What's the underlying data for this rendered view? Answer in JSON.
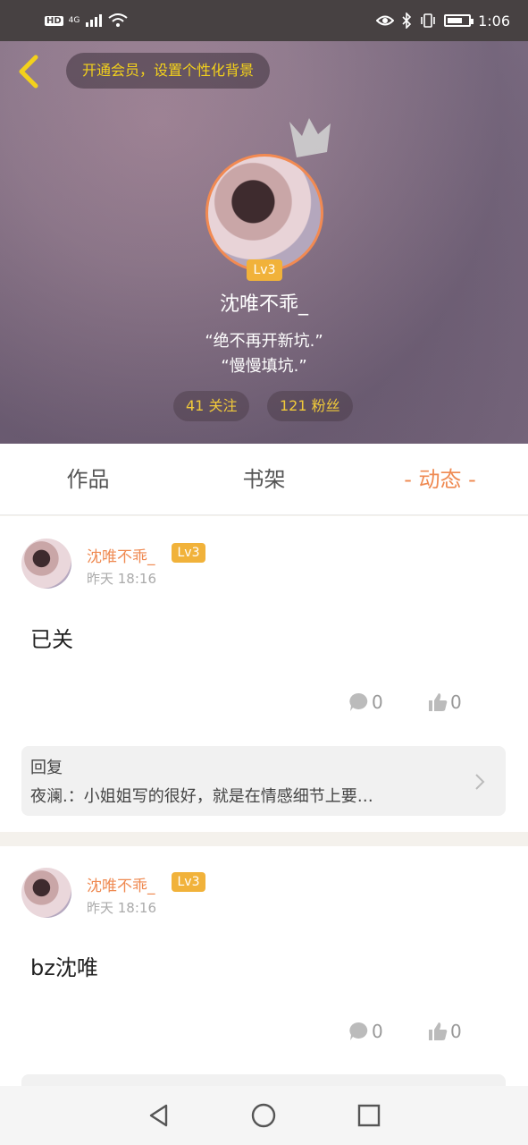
{
  "status_bar": {
    "left_labels": [
      "HD",
      "4G"
    ],
    "time": "1:06"
  },
  "header": {
    "vip_label": "开通会员，设置个性化背景",
    "level": "Lv3",
    "username": "沈唯不乖_",
    "motto_line1": "“绝不再开新坑.”",
    "motto_line2": "“慢慢填坑.”",
    "follow_label": "41 关注",
    "fans_label": "121 粉丝"
  },
  "tabs": [
    {
      "label": "作品"
    },
    {
      "label": "书架"
    },
    {
      "label": "- 动态 -"
    }
  ],
  "posts": [
    {
      "author": "沈唯不乖_",
      "level": "Lv3",
      "time": "昨天 18:16",
      "text": "已关",
      "comment_count": "0",
      "like_count": "0",
      "reply_title": "回复",
      "reply_text": "夜澜.：小姐姐写的很好，就是在情感细节上要…"
    },
    {
      "author": "沈唯不乖_",
      "level": "Lv3",
      "time": "昨天 18:16",
      "text": "bz沈唯",
      "comment_count": "0",
      "like_count": "0"
    }
  ],
  "colors": {
    "accent": "#ef8a52",
    "level_badge": "#f1b23a",
    "vip_text": "#f3d11b"
  }
}
